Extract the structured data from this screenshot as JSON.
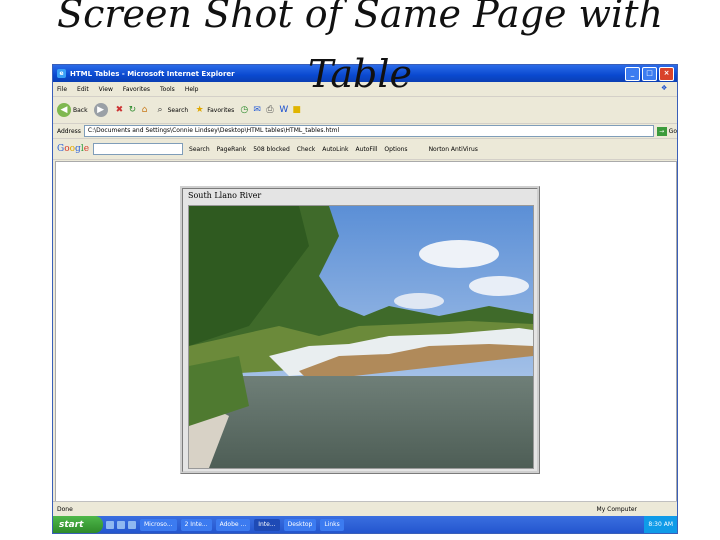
{
  "slide": {
    "title": "Screen Shot of Same Page with\nTable"
  },
  "window": {
    "title": "HTML Tables - Microsoft Internet Explorer",
    "minimize": "_",
    "maximize": "□",
    "close": "×"
  },
  "menu": {
    "items": [
      "File",
      "Edit",
      "View",
      "Favorites",
      "Tools",
      "Help"
    ]
  },
  "toolbar": {
    "back": "Back",
    "search": "Search",
    "favorites": "Favorites"
  },
  "address": {
    "label": "Address",
    "value": "C:\\Documents and Settings\\Connie Lindsey\\Desktop\\HTML tables\\HTML_tables.html",
    "go": "Go"
  },
  "googlebar": {
    "search": "Search",
    "pagerank": "PageRank",
    "blocked": "508 blocked",
    "check": "Check",
    "autolink": "AutoLink",
    "autofill": "AutoFill",
    "options": "Options",
    "norton": "Norton AntiVirus"
  },
  "page": {
    "caption": "South Llano River"
  },
  "status": {
    "left": "Done",
    "right": "My Computer"
  },
  "taskbar": {
    "start": "start",
    "tasks": [
      "Microso...",
      "2 Inte...",
      "Adobe ...",
      "Inte...",
      "Desktop",
      "Links"
    ],
    "clock": "8:30 AM"
  },
  "colors": {
    "titlebar": "#0a49d0",
    "chrome": "#ece9d8",
    "start": "#2e8a2a"
  }
}
